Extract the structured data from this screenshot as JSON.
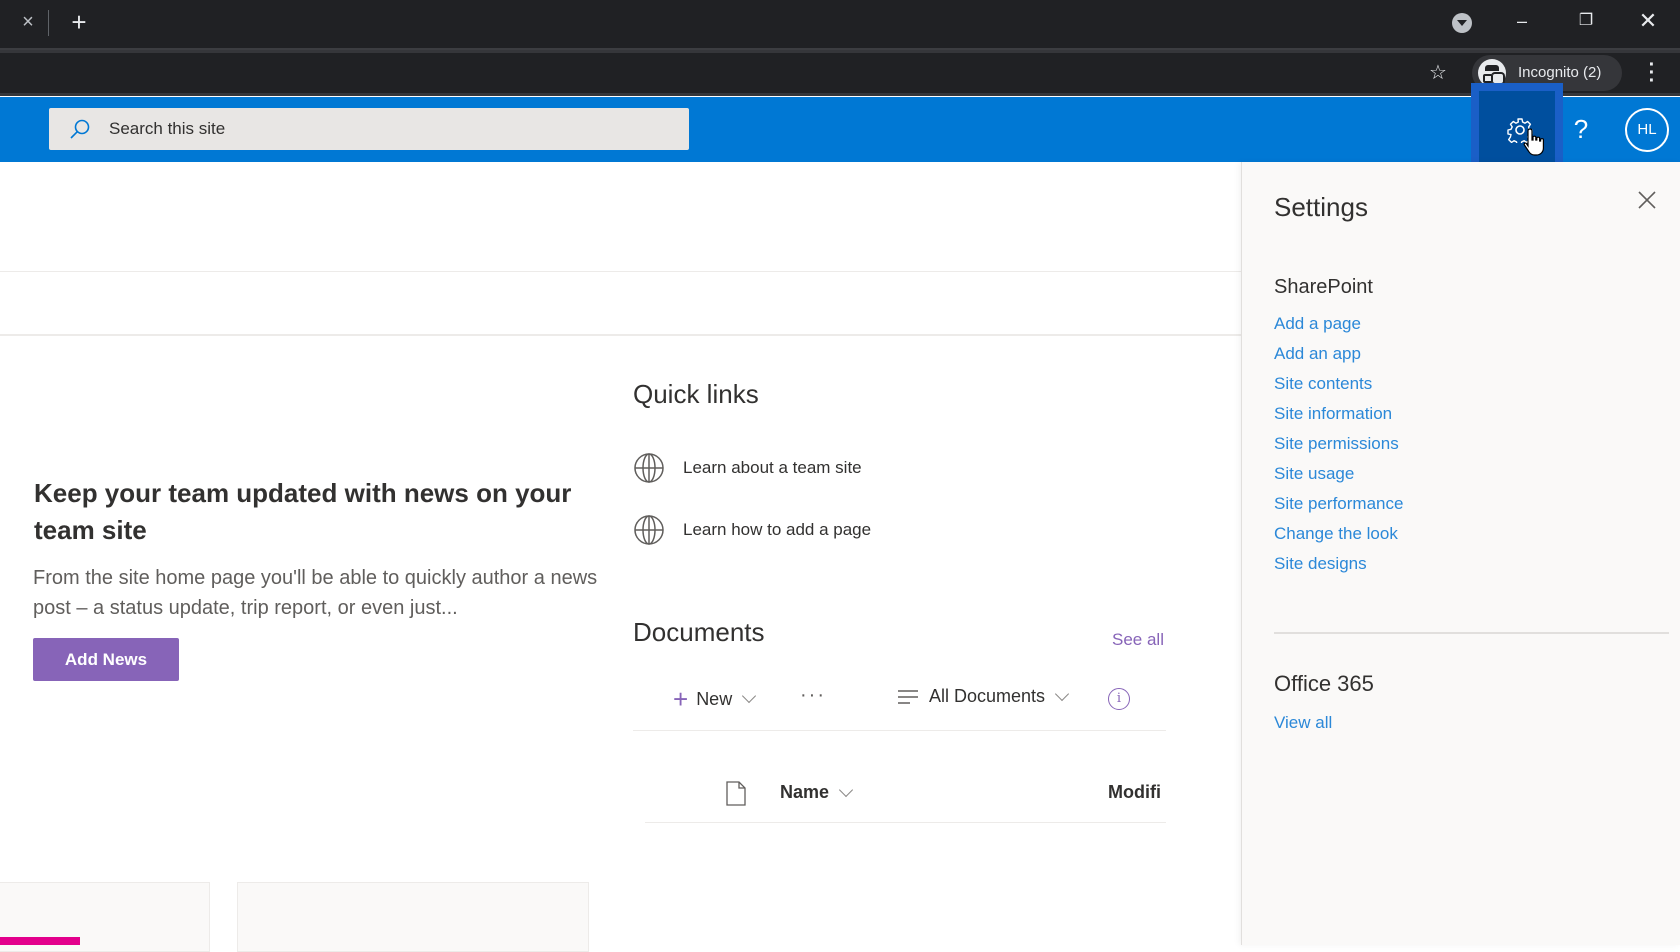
{
  "browser": {
    "tab_close_icon": "×",
    "new_tab_icon": "+",
    "window_controls": {
      "minimize": "–",
      "restore": "❐",
      "close": "✕"
    },
    "bookmark_icon": "☆",
    "profile_label": "Incognito (2)",
    "menu_icon": "⋮"
  },
  "suitebar": {
    "search_placeholder": "Search this site",
    "help_icon": "?",
    "avatar_initials": "HL",
    "accent_color": "#0078d4"
  },
  "news": {
    "title": "Keep your team updated with news on your team site",
    "body": "From the site home page you'll be able to quickly author a news post – a status update, trip report, or even just...",
    "add_button": "Add News",
    "button_color": "#8764b8"
  },
  "quick_links": {
    "title": "Quick links",
    "items": [
      {
        "label": "Learn about a team site"
      },
      {
        "label": "Learn how to add a page"
      }
    ]
  },
  "documents": {
    "title": "Documents",
    "see_all": "See all",
    "new_label": "New",
    "more_label": "···",
    "view_label": "All Documents",
    "info_icon": "i",
    "columns": {
      "name": "Name",
      "modified": "Modifi"
    }
  },
  "settings_panel": {
    "title": "Settings",
    "sharepoint_heading": "SharePoint",
    "sharepoint_links": [
      "Add a page",
      "Add an app",
      "Site contents",
      "Site information",
      "Site permissions",
      "Site usage",
      "Site performance",
      "Change the look",
      "Site designs"
    ],
    "office_heading": "Office 365",
    "office_link": "View all",
    "link_color": "#2b88d8"
  }
}
